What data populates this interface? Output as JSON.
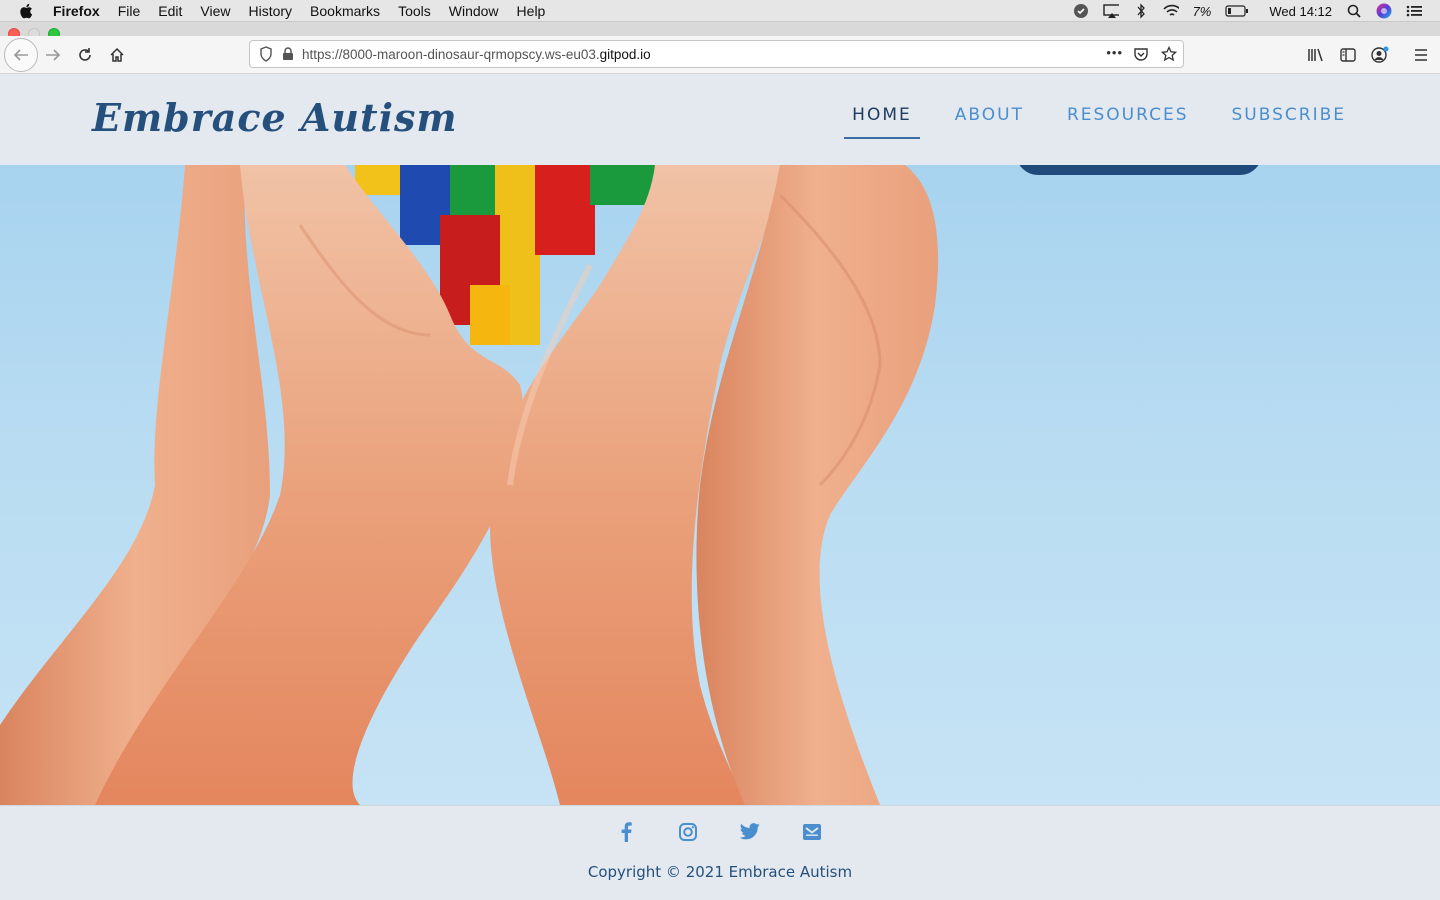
{
  "menubar": {
    "app_name": "Firefox",
    "items": [
      "File",
      "Edit",
      "View",
      "History",
      "Bookmarks",
      "Tools",
      "Window",
      "Help"
    ],
    "battery": "7%",
    "clock": "Wed 14:12"
  },
  "browser": {
    "url_prefix": "https://8000-maroon-dinosaur-qrmopscy.ws-eu03.",
    "url_domain": "gitpod.io",
    "more_glyph": "•••"
  },
  "site": {
    "brand": "Embrace Autism",
    "nav": [
      {
        "label": "HOME",
        "active": true
      },
      {
        "label": "ABOUT",
        "active": false
      },
      {
        "label": "RESOURCES",
        "active": false
      },
      {
        "label": "SUBSCRIBE",
        "active": false
      }
    ],
    "colors": {
      "brand": "#25507d",
      "nav_link": "#4a8ed0",
      "nav_active": "#1f3c60",
      "footer_bg": "#e3e9ee"
    }
  },
  "footer": {
    "social_icons": [
      "facebook-icon",
      "instagram-icon",
      "twitter-icon",
      "email-icon"
    ],
    "copyright": "Copyright © 2021 Embrace Autism"
  }
}
